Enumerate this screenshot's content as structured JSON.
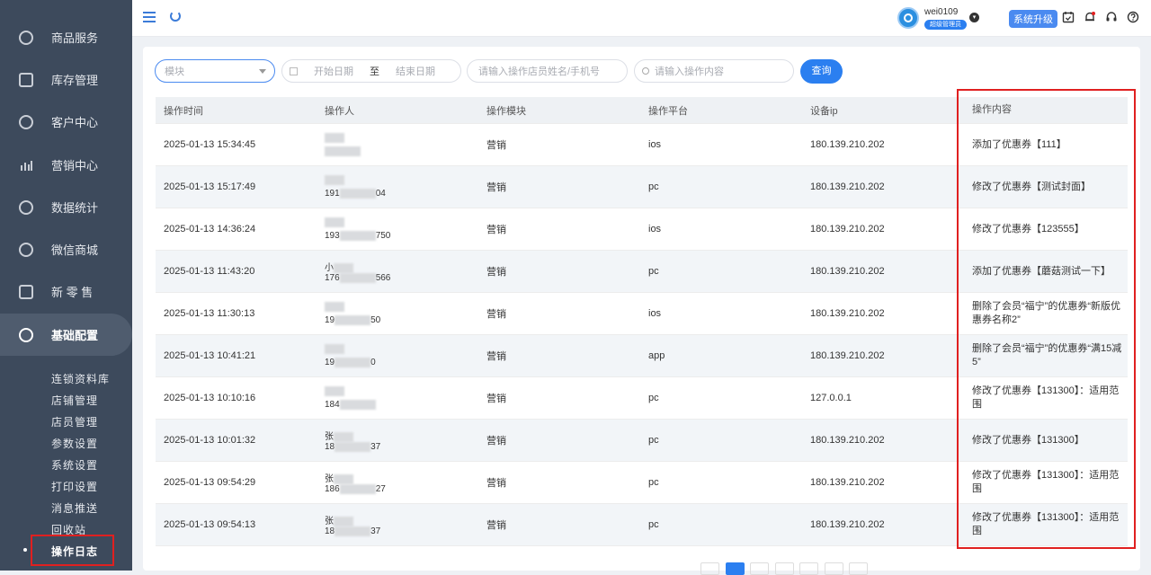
{
  "sidebar": {
    "items": [
      {
        "label": "商品服务",
        "icon": "bag-icon"
      },
      {
        "label": "库存管理",
        "icon": "inventory-icon"
      },
      {
        "label": "客户中心",
        "icon": "customer-icon"
      },
      {
        "label": "营销中心",
        "icon": "marketing-chart-icon"
      },
      {
        "label": "数据统计",
        "icon": "statistics-icon"
      },
      {
        "label": "微信商城",
        "icon": "wechat-icon"
      },
      {
        "label": "新 零 售",
        "icon": "cube-icon"
      },
      {
        "label": "基础配置",
        "icon": "settings-target-icon"
      }
    ],
    "sub_items": [
      "连锁资料库",
      "店铺管理",
      "店员管理",
      "参数设置",
      "系统设置",
      "打印设置",
      "消息推送",
      "回收站",
      "操作日志"
    ]
  },
  "topbar": {
    "user_name": "wei0109",
    "role": "超级管理员",
    "upgrade_label": "系统升级"
  },
  "filters": {
    "module_placeholder": "模块",
    "start_date_placeholder": "开始日期",
    "date_separator": "至",
    "end_date_placeholder": "结束日期",
    "name_placeholder": "请输入操作店员姓名/手机号",
    "content_placeholder": "请输入操作内容",
    "query_label": "查询"
  },
  "table": {
    "headers": [
      "操作时间",
      "操作人",
      "操作模块",
      "操作平台",
      "设备ip",
      "操作内容"
    ],
    "rows": [
      {
        "time": "2025-01-13 15:34:45",
        "name": "",
        "phone": "",
        "module": "营销",
        "platform": "ios",
        "ip": "180.139.210.202",
        "content": "添加了优惠券【111】"
      },
      {
        "time": "2025-01-13 15:17:49",
        "name": "",
        "phone": "191",
        "phone_tail": "04",
        "module": "营销",
        "platform": "pc",
        "ip": "180.139.210.202",
        "content": "修改了优惠券【测试封面】"
      },
      {
        "time": "2025-01-13 14:36:24",
        "name": "",
        "phone": "193",
        "phone_tail": "750",
        "module": "营销",
        "platform": "ios",
        "ip": "180.139.210.202",
        "content": "修改了优惠券【123555】"
      },
      {
        "time": "2025-01-13 11:43:20",
        "name": "小",
        "phone": "176",
        "phone_tail": "566",
        "module": "营销",
        "platform": "pc",
        "ip": "180.139.210.202",
        "content": "添加了优惠券【蘑菇测试一下】"
      },
      {
        "time": "2025-01-13 11:30:13",
        "name": "",
        "phone": "19",
        "phone_tail": "50",
        "module": "营销",
        "platform": "ios",
        "ip": "180.139.210.202",
        "content": "删除了会员“福宁”的优惠券“新版优惠券名称2”"
      },
      {
        "time": "2025-01-13 10:41:21",
        "name": "",
        "phone": "19",
        "phone_tail": "0",
        "module": "营销",
        "platform": "app",
        "ip": "180.139.210.202",
        "content": "删除了会员“福宁”的优惠券“满15减5”"
      },
      {
        "time": "2025-01-13 10:10:16",
        "name": "",
        "phone": "184",
        "phone_tail": "",
        "module": "营销",
        "platform": "pc",
        "ip": "127.0.0.1",
        "content": "修改了优惠券【131300】：适用范围"
      },
      {
        "time": "2025-01-13 10:01:32",
        "name": "张",
        "phone": "18",
        "phone_tail": "37",
        "module": "营销",
        "platform": "pc",
        "ip": "180.139.210.202",
        "content": "修改了优惠券【131300】"
      },
      {
        "time": "2025-01-13 09:54:29",
        "name": "张",
        "phone": "186",
        "phone_tail": "27",
        "module": "营销",
        "platform": "pc",
        "ip": "180.139.210.202",
        "content": "修改了优惠券【131300】：适用范围"
      },
      {
        "time": "2025-01-13 09:54:13",
        "name": "张",
        "phone": "18",
        "phone_tail": "37",
        "module": "营销",
        "platform": "pc",
        "ip": "180.139.210.202",
        "content": "修改了优惠券【131300】：适用范围"
      }
    ]
  },
  "pagination": {
    "current_page": "1"
  },
  "colors": {
    "primary": "#2b7ff0",
    "sidebar": "#3d4a5c",
    "highlight": "#e02020"
  }
}
